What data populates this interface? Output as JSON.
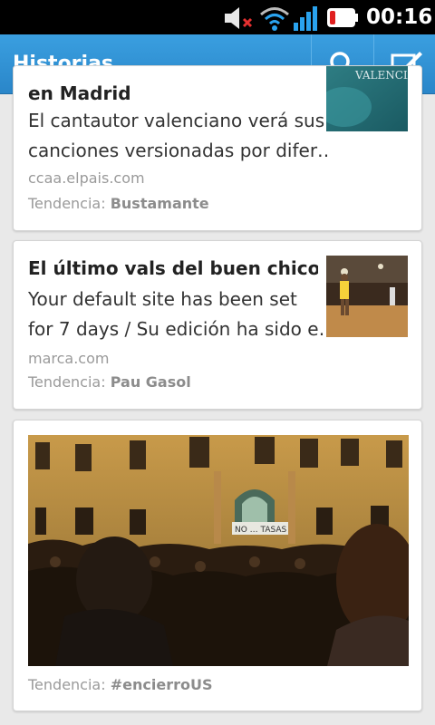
{
  "status_bar": {
    "time": "00:16",
    "icons": [
      "mute-icon",
      "wifi-icon",
      "signal-icon",
      "battery-icon"
    ]
  },
  "action_bar": {
    "title": "Historias",
    "actions": [
      "search-icon",
      "compose-icon"
    ]
  },
  "stories": [
    {
      "title": "en Madrid",
      "body_lines": [
        "El cantautor valenciano verá sus",
        "canciones versionadas por difer…"
      ],
      "source": "ccaa.elpais.com",
      "trend_label": "Tendencia:",
      "trend": "Bustamante",
      "thumb_text": "VALENCIANA"
    },
    {
      "title": "El último vals del buen chico",
      "body_lines": [
        "Your default site has been set",
        "for 7 days / Su edición ha sido e…"
      ],
      "source": "marca.com",
      "trend_label": "Tendencia:",
      "trend": "Pau Gasol"
    },
    {
      "trend_label": "Tendencia:",
      "trend": "#encierroUS",
      "banner_text": "NO … TASAS"
    }
  ],
  "colors": {
    "action_bar": "#2a86c9",
    "background": "#e9e9e9",
    "card": "#ffffff"
  }
}
